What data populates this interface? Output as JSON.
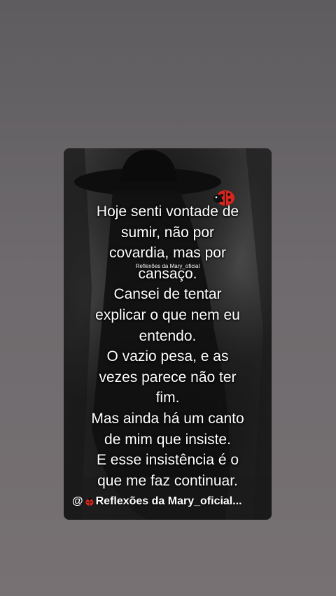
{
  "post": {
    "lines": [
      "Hoje senti vontade de",
      "sumir,  não por",
      "covardia, mas por",
      "cansaço.",
      "Cansei de tentar",
      "explicar o que nem eu",
      "entendo.",
      "O vazio pesa, e as",
      "vezes parece não ter",
      "fim.",
      "Mas ainda há um canto",
      "de mim que insiste.",
      "E esse insistência é o",
      "que me faz continuar."
    ],
    "watermark": "Reflexões da Mary_oficial",
    "footer_prefix": "@",
    "footer_name": "Reflexões da Mary_oficial...",
    "icons": {
      "top": "ladybug-icon",
      "footer": "ladybug-icon"
    }
  }
}
